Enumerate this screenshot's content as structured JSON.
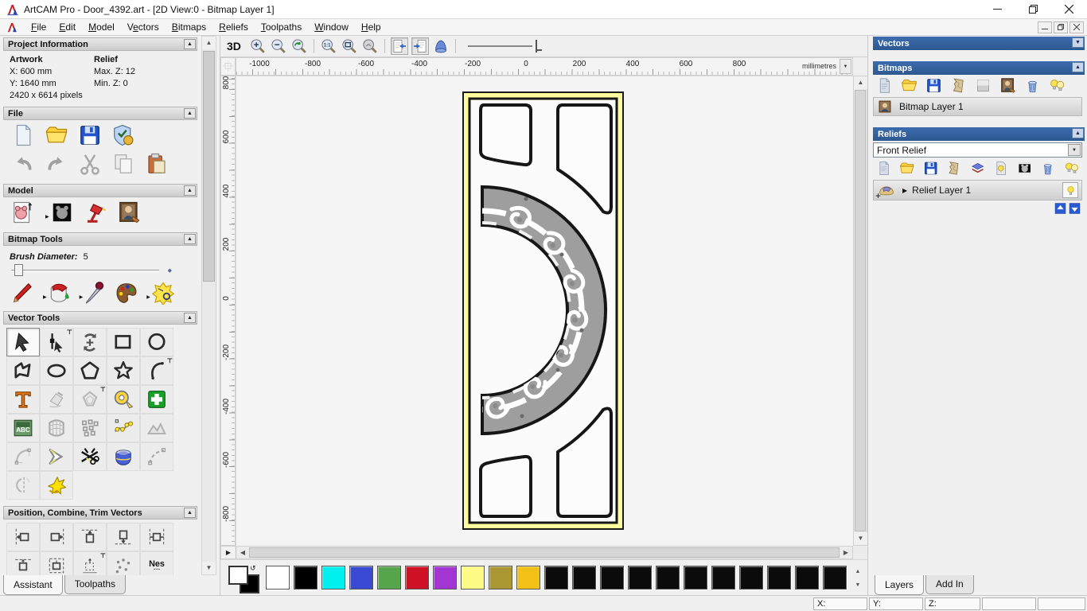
{
  "window": {
    "title": "ArtCAM Pro - Door_4392.art - [2D View:0 - Bitmap Layer 1]",
    "controls": [
      "minimize-icon",
      "restore-icon",
      "close-icon"
    ]
  },
  "menu": {
    "items": [
      {
        "label": "File",
        "accel": 0
      },
      {
        "label": "Edit",
        "accel": 0
      },
      {
        "label": "Model",
        "accel": 0
      },
      {
        "label": "Vectors",
        "accel": 1
      },
      {
        "label": "Bitmaps",
        "accel": 0
      },
      {
        "label": "Reliefs",
        "accel": 0
      },
      {
        "label": "Toolpaths",
        "accel": 0
      },
      {
        "label": "Window",
        "accel": 0
      },
      {
        "label": "Help",
        "accel": 0
      }
    ],
    "child_controls": [
      "minimize-icon",
      "restore-icon",
      "close-icon"
    ]
  },
  "assistant": {
    "project_information": {
      "title": "Project Information",
      "artwork_label": "Artwork",
      "relief_label": "Relief",
      "x": "X: 600 mm",
      "y": "Y: 1640 mm",
      "pixels": "2420 x 6614 pixels",
      "max_z": "Max. Z: 12",
      "min_z": "Min. Z: 0"
    },
    "file": {
      "title": "File",
      "row1": [
        {
          "name": "new-document-icon"
        },
        {
          "name": "open-file-icon"
        },
        {
          "name": "save-icon"
        },
        {
          "name": "options-icon"
        }
      ],
      "row2": [
        {
          "name": "undo-icon"
        },
        {
          "name": "redo-icon"
        },
        {
          "name": "cut-icon"
        },
        {
          "name": "copy-icon"
        },
        {
          "name": "paste-icon"
        }
      ]
    },
    "model": {
      "title": "Model",
      "icons": [
        {
          "name": "set-model-size-icon",
          "flyout": true
        },
        {
          "name": "invert-model-icon"
        },
        {
          "name": "lighting-icon"
        },
        {
          "name": "load-texture-icon"
        }
      ]
    },
    "bitmap_tools": {
      "title": "Bitmap Tools",
      "brush_diameter_label": "Brush Diameter:",
      "brush_diameter_value": "5",
      "icons": [
        {
          "name": "paint-icon",
          "flyout": true
        },
        {
          "name": "flood-fill-icon",
          "flyout": true
        },
        {
          "name": "pick-colour-icon"
        },
        {
          "name": "colour-palette-icon",
          "flyout": true
        },
        {
          "name": "reduce-colours-icon"
        }
      ]
    },
    "vector_tools": {
      "title": "Vector Tools",
      "rows": [
        [
          {
            "name": "select-vectors-icon",
            "selected": true
          },
          {
            "name": "node-editing-icon",
            "pin": true
          },
          {
            "name": "transform-vectors-icon"
          },
          {
            "name": "create-rectangle-icon"
          },
          {
            "name": "create-circle-icon"
          }
        ],
        [
          {
            "name": "create-polyline-icon"
          },
          {
            "name": "create-ellipse-icon"
          },
          {
            "name": "create-polygon-icon"
          },
          {
            "name": "create-star-icon"
          },
          {
            "name": "create-arc-icon",
            "pin": true
          }
        ],
        [
          {
            "name": "create-text-icon"
          },
          {
            "name": "wrap-text-icon"
          },
          {
            "name": "offset-vectors-icon",
            "pin": true
          },
          {
            "name": "measure-tool-icon"
          },
          {
            "name": "snap-grid-icon"
          }
        ],
        [
          {
            "name": "text-block-icon"
          },
          {
            "name": "envelope-distort-icon"
          },
          {
            "name": "block-copy-icon"
          },
          {
            "name": "paste-along-curve-icon"
          },
          {
            "name": "fit-vectors-icon"
          }
        ],
        [
          {
            "name": "fillet-tool-icon"
          },
          {
            "name": "arrow-tool-icon"
          },
          {
            "name": "trim-vectors-icon"
          },
          {
            "name": "weld-vectors-icon"
          },
          {
            "name": "create-spline-icon"
          }
        ],
        [
          {
            "name": "mirror-vectors-icon"
          },
          {
            "name": "star-burst-icon"
          }
        ]
      ]
    },
    "position_combine": {
      "title": "Position, Combine, Trim Vectors",
      "row1": [
        {
          "name": "align-left-icon"
        },
        {
          "name": "align-right-icon"
        },
        {
          "name": "align-top-icon"
        },
        {
          "name": "align-bottom-icon"
        },
        {
          "name": "align-centre-icon"
        }
      ],
      "row2": [
        {
          "name": "align-up-icon"
        },
        {
          "name": "align-inside-icon"
        },
        {
          "name": "align-contour-icon",
          "pin": true
        },
        {
          "name": "scatter-copies-icon"
        },
        {
          "name": "nesting-icon"
        }
      ]
    },
    "tabs": [
      {
        "label": "Assistant",
        "active": true
      },
      {
        "label": "Toolpaths",
        "active": false
      }
    ]
  },
  "canvas": {
    "toolbar": {
      "view_3d_label": "3D",
      "items": [
        {
          "name": "zoom-in-icon"
        },
        {
          "name": "zoom-out-icon"
        },
        {
          "name": "zoom-previous-icon"
        },
        {
          "sep": true
        },
        {
          "name": "zoom-1to1-icon"
        },
        {
          "name": "zoom-fit-icon"
        },
        {
          "name": "zoom-object-icon"
        },
        {
          "sep": true
        },
        {
          "name": "toggle-left-pane-icon",
          "pressed": true
        },
        {
          "name": "toggle-right-pane-icon",
          "pressed": true
        },
        {
          "name": "simulate-icon"
        },
        {
          "sep": true
        }
      ]
    },
    "ruler": {
      "h_values": [
        -1000,
        -800,
        -600,
        -400,
        -200,
        0,
        200,
        400,
        600,
        800
      ],
      "v_values": [
        800,
        600,
        400,
        200,
        0,
        -200,
        -400,
        -600,
        -800
      ],
      "units": "millimetres"
    }
  },
  "palette": {
    "colors": [
      "#ffffff",
      "#000000",
      "#00f0f0",
      "#3a4ad2",
      "#56a44c",
      "#cf1126",
      "#a335d2",
      "#fdfa86",
      "#ab9734",
      "#f1c116",
      "#0b0b0b",
      "#0b0b0b",
      "#0b0b0b",
      "#0b0b0b",
      "#0b0b0b",
      "#0b0b0b",
      "#0b0b0b",
      "#0b0b0b",
      "#0b0b0b",
      "#0b0b0b",
      "#0b0b0b"
    ],
    "primary": "#ffffff",
    "secondary": "#000000"
  },
  "layers_panel": {
    "vectors": {
      "title": "Vectors"
    },
    "bitmaps": {
      "title": "Bitmaps",
      "toolbar": [
        {
          "name": "new-layer-icon"
        },
        {
          "name": "open-file-icon"
        },
        {
          "name": "save-icon"
        },
        {
          "name": "crumple-icon"
        },
        {
          "name": "blend-icon"
        },
        {
          "name": "load-texture-icon"
        },
        {
          "name": "delete-layer-icon"
        },
        {
          "name": "visibility-icon"
        }
      ],
      "layer_name": "Bitmap Layer 1"
    },
    "reliefs": {
      "title": "Reliefs",
      "combo_value": "Front Relief",
      "toolbar": [
        {
          "name": "new-layer-icon"
        },
        {
          "name": "open-file-icon"
        },
        {
          "name": "save-icon"
        },
        {
          "name": "crumple-icon"
        },
        {
          "name": "stack-icon"
        },
        {
          "name": "highlight-icon"
        },
        {
          "name": "negative-icon"
        },
        {
          "name": "delete-layer-icon"
        },
        {
          "name": "visibility-icon"
        }
      ],
      "layer_name": "Relief Layer 1"
    },
    "move_buttons": [
      {
        "name": "up-blue-icon"
      },
      {
        "name": "down-blue-icon"
      }
    ],
    "tabs": [
      {
        "label": "Layers",
        "active": true
      },
      {
        "label": "Add In",
        "active": false
      }
    ]
  },
  "status_bar": {
    "fields": [
      "X:",
      "Y:",
      "Z:",
      "",
      ""
    ]
  }
}
